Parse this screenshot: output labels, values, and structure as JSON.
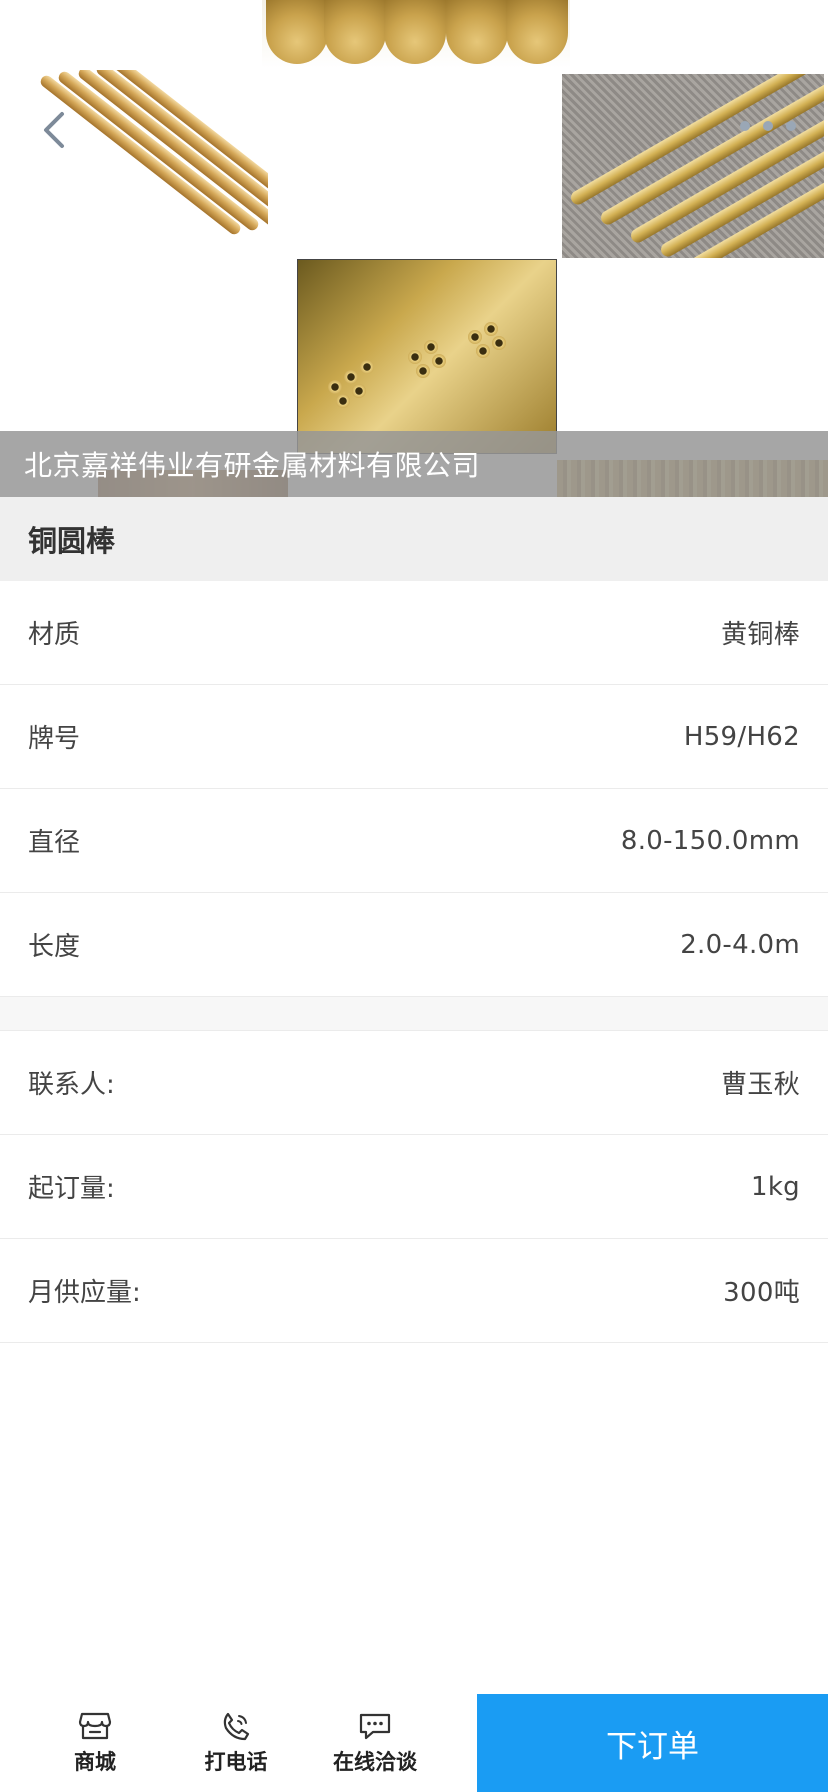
{
  "header": {
    "company_name": "北京嘉祥伟业有研金属材料有限公司",
    "back_icon": "chevron-left-icon",
    "more_icon": "more-dots-icon"
  },
  "product": {
    "title": "铜圆棒"
  },
  "specs": [
    {
      "label": "材质",
      "value": "黄铜棒"
    },
    {
      "label": "牌号",
      "value": "H59/H62"
    },
    {
      "label": "直径",
      "value": "8.0-150.0mm"
    },
    {
      "label": "长度",
      "value": "2.0-4.0m"
    }
  ],
  "contact": [
    {
      "label": "联系人:",
      "value": "曹玉秋"
    },
    {
      "label": "起订量:",
      "value": "1kg"
    },
    {
      "label": "月供应量:",
      "value": "300吨"
    }
  ],
  "bottom_bar": {
    "store": {
      "label": "商城",
      "icon": "store-icon"
    },
    "call": {
      "label": "打电话",
      "icon": "phone-icon"
    },
    "chat": {
      "label": "在线洽谈",
      "icon": "chat-icon"
    },
    "order_label": "下订单"
  },
  "colors": {
    "accent": "#1a9cf3",
    "title_band": "#efefef",
    "overlay": "#969696"
  }
}
